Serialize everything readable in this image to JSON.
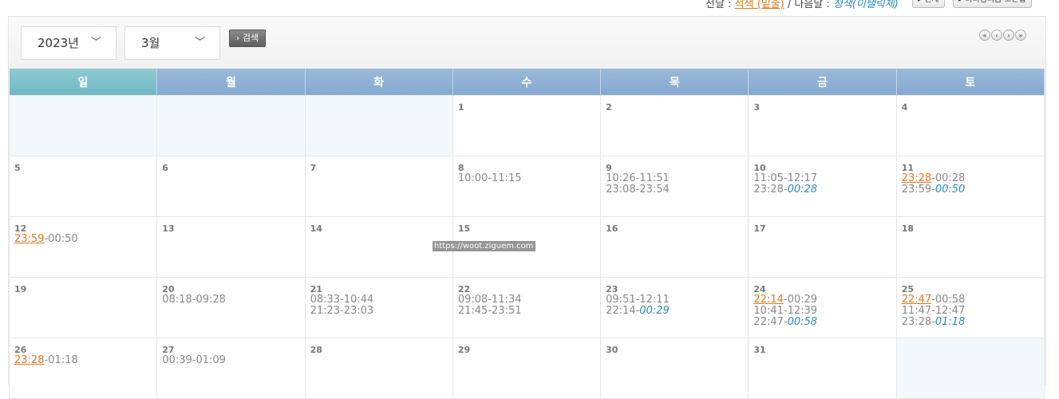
{
  "legend": {
    "prev_label": "전날 : ",
    "prev_color_name": "적색 (밑줄)",
    "separator": " / ",
    "next_label": "다음날 : ",
    "next_color_name": "청색(이탤릭체)"
  },
  "top_buttons": [
    "▸ 전체",
    "▸ 미디엄리움 오픈합"
  ],
  "controls": {
    "year": "2023년",
    "month": "3월",
    "search_label": "› 검색",
    "nav": [
      "«",
      "‹",
      "›",
      "»"
    ]
  },
  "weekdays": [
    "일",
    "월",
    "화",
    "수",
    "목",
    "금",
    "토"
  ],
  "weeks": [
    [
      {
        "day": "",
        "times": []
      },
      {
        "day": "",
        "times": []
      },
      {
        "day": "",
        "times": []
      },
      {
        "day": "1",
        "times": []
      },
      {
        "day": "2",
        "times": []
      },
      {
        "day": "3",
        "times": []
      },
      {
        "day": "4",
        "times": []
      }
    ],
    [
      {
        "day": "5",
        "times": []
      },
      {
        "day": "6",
        "times": []
      },
      {
        "day": "7",
        "times": []
      },
      {
        "day": "8",
        "times": [
          {
            "s": "10:00",
            "e": "11:15"
          }
        ]
      },
      {
        "day": "9",
        "times": [
          {
            "s": "10:26",
            "e": "11:51"
          },
          {
            "s": "23:08",
            "e": "23:54"
          }
        ]
      },
      {
        "day": "10",
        "times": [
          {
            "s": "11:05",
            "e": "12:17"
          },
          {
            "s": "23:28",
            "e": "00:28",
            "next": true
          }
        ]
      },
      {
        "day": "11",
        "times": [
          {
            "s": "23:28",
            "e": "00:28",
            "prev": true
          },
          {
            "s": "23:59",
            "e": "00:50",
            "next": true
          }
        ]
      }
    ],
    [
      {
        "day": "12",
        "times": [
          {
            "s": "23:59",
            "e": "00:50",
            "prev": true
          }
        ]
      },
      {
        "day": "13",
        "times": []
      },
      {
        "day": "14",
        "times": []
      },
      {
        "day": "15",
        "times": []
      },
      {
        "day": "16",
        "times": []
      },
      {
        "day": "17",
        "times": []
      },
      {
        "day": "18",
        "times": []
      }
    ],
    [
      {
        "day": "19",
        "times": []
      },
      {
        "day": "20",
        "times": [
          {
            "s": "08:18",
            "e": "09:28"
          }
        ]
      },
      {
        "day": "21",
        "times": [
          {
            "s": "08:33",
            "e": "10:44"
          },
          {
            "s": "21:23",
            "e": "23:03"
          }
        ]
      },
      {
        "day": "22",
        "times": [
          {
            "s": "09:08",
            "e": "11:34"
          },
          {
            "s": "21:45",
            "e": "23:51"
          }
        ]
      },
      {
        "day": "23",
        "times": [
          {
            "s": "09:51",
            "e": "12:11"
          },
          {
            "s": "22:14",
            "e": "00:29",
            "next": true
          }
        ]
      },
      {
        "day": "24",
        "times": [
          {
            "s": "22:14",
            "e": "00:29",
            "prev": true
          },
          {
            "s": "10:41",
            "e": "12:39"
          },
          {
            "s": "22:47",
            "e": "00:58",
            "next": true
          }
        ]
      },
      {
        "day": "25",
        "times": [
          {
            "s": "22:47",
            "e": "00:58",
            "prev": true
          },
          {
            "s": "11:47",
            "e": "12:47"
          },
          {
            "s": "23:28",
            "e": "01:18",
            "next": true
          }
        ]
      }
    ],
    [
      {
        "day": "26",
        "times": [
          {
            "s": "23:28",
            "e": "01:18",
            "prev": true
          }
        ]
      },
      {
        "day": "27",
        "times": [
          {
            "s": "00:39",
            "e": "01:09"
          }
        ]
      },
      {
        "day": "28",
        "times": []
      },
      {
        "day": "29",
        "times": []
      },
      {
        "day": "30",
        "times": []
      },
      {
        "day": "31",
        "times": []
      },
      {
        "day": "",
        "times": []
      }
    ]
  ],
  "watermark": "https://woot.ziguem.com",
  "colors": {
    "prev": "#e07b20",
    "next": "#2d8ab7",
    "header": "#8eb0d5",
    "sunday_header": "#7dc1cb"
  }
}
